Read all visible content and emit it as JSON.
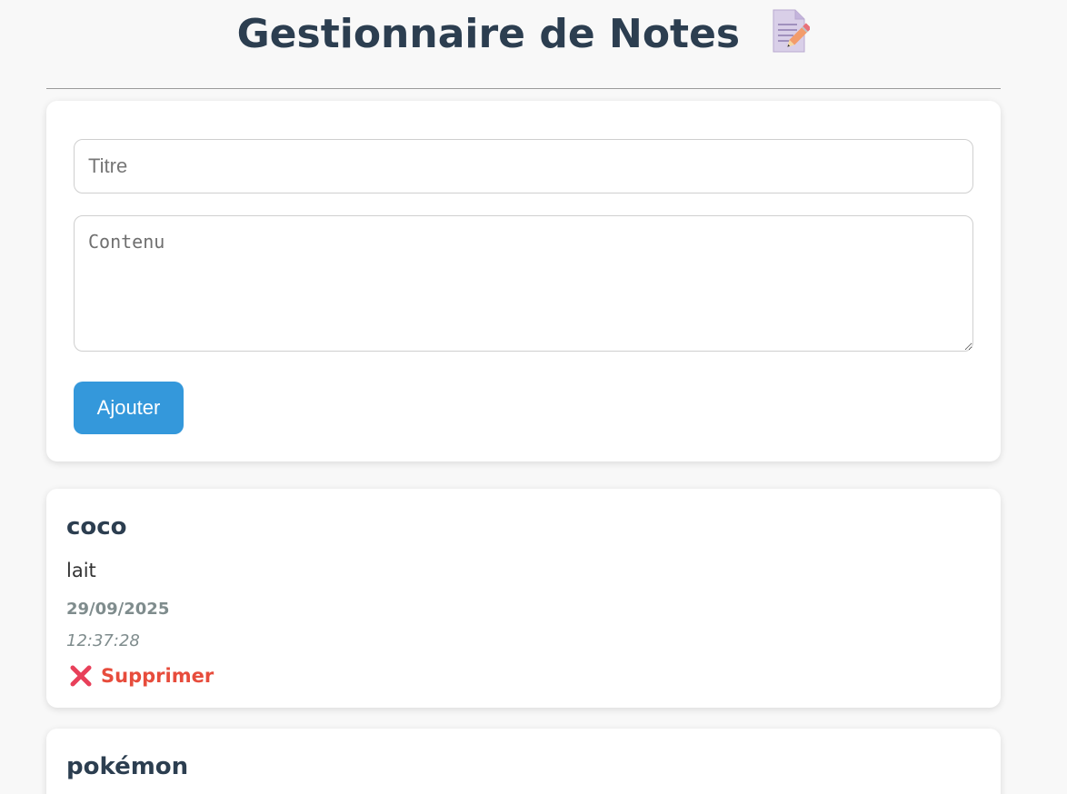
{
  "header": {
    "title": "Gestionnaire de Notes",
    "icon": "memo-icon"
  },
  "form": {
    "title_placeholder": "Titre",
    "title_value": "",
    "content_placeholder": "Contenu",
    "content_value": "",
    "add_label": "Ajouter"
  },
  "notes": [
    {
      "title": "coco",
      "content": "lait",
      "date": "29/09/2025",
      "time": "12:37:28",
      "delete_label": "Supprimer"
    },
    {
      "title": "pokémon"
    }
  ],
  "colors": {
    "accent": "#3498db",
    "title": "#2c3e50",
    "danger": "#e74c3c",
    "muted": "#7f8c8d",
    "background": "#f8f8f8"
  }
}
